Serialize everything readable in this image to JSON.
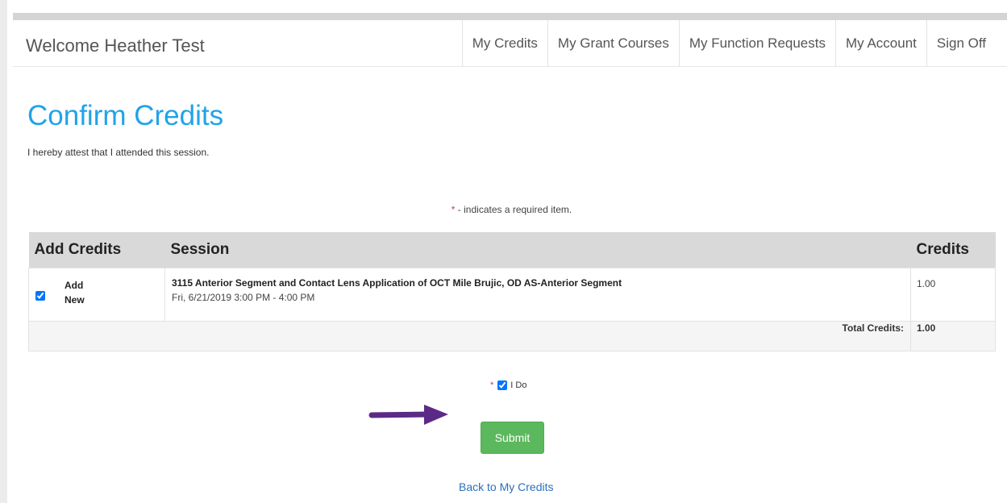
{
  "navbar": {
    "welcome": "Welcome Heather Test",
    "links": [
      "My Credits",
      "My Grant Courses",
      "My Function Requests",
      "My Account",
      "Sign Off"
    ]
  },
  "page": {
    "title": "Confirm Credits",
    "attest_text": "I hereby attest that I attended this session.",
    "required_star": "*",
    "required_note": " - indicates a required item."
  },
  "table": {
    "headers": [
      "Add Credits",
      "Session",
      "Credits"
    ],
    "rows": [
      {
        "add_label_line1": "Add",
        "add_label_line2": "New",
        "checked": true,
        "session_title": "3115 Anterior Segment and Contact Lens Application of OCT Mile Brujic, OD AS-Anterior Segment",
        "session_time": "Fri, 6/21/2019 3:00 PM - 4:00 PM",
        "credits": "1.00"
      }
    ],
    "total_label": "Total Credits:",
    "total_value": "1.00"
  },
  "confirm": {
    "star": "*",
    "label": "I Do",
    "checked": true
  },
  "actions": {
    "submit_label": "Submit",
    "back_label": "Back to My Credits"
  },
  "colors": {
    "title": "#21a3e8",
    "submit": "#5cb85c",
    "arrow": "#5b2a86",
    "link": "#2a6fbf"
  }
}
